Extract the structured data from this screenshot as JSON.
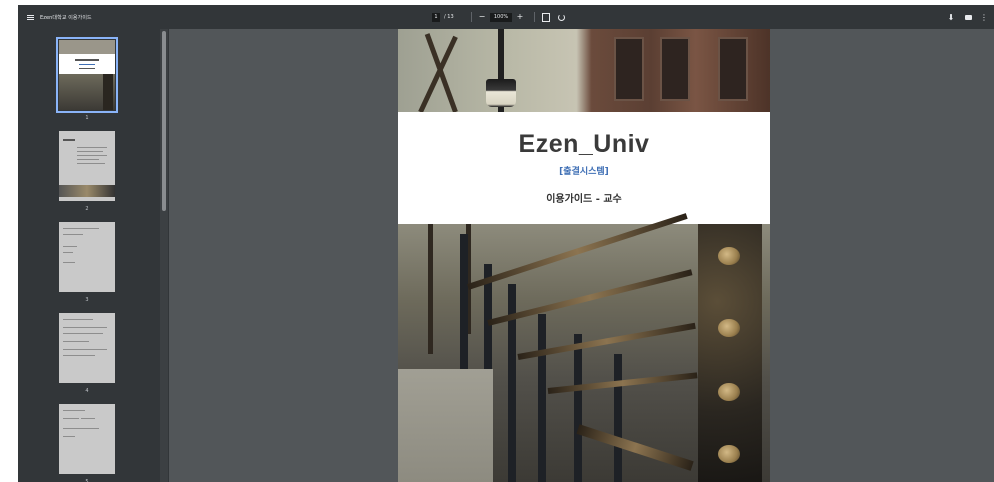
{
  "toolbar": {
    "title": "Ezen대학교 이용가이드",
    "current_page": "1",
    "page_total": "/ 13",
    "zoom_out": "−",
    "zoom_level": "100%",
    "zoom_in": "+",
    "download_glyph": "⬇",
    "more_glyph": "⋮",
    "icons": [
      "menu-icon",
      "fit-page-icon",
      "rotate-icon",
      "download-icon",
      "print-icon",
      "more-options-icon"
    ]
  },
  "sidebar": {
    "thumbnails": [
      {
        "number": "1",
        "active": true
      },
      {
        "number": "2",
        "active": false
      },
      {
        "number": "3",
        "active": false
      },
      {
        "number": "4",
        "active": false
      },
      {
        "number": "5",
        "active": false
      }
    ]
  },
  "document": {
    "heading": "Ezen_Univ",
    "subtitle": "[출결시스템]",
    "guide": "이용가이드 - 교수"
  },
  "colors": {
    "viewer_bg": "#525659",
    "toolbar_bg": "#323639",
    "accent": "#8ab4f8",
    "subtitle": "#3f6fb5"
  }
}
